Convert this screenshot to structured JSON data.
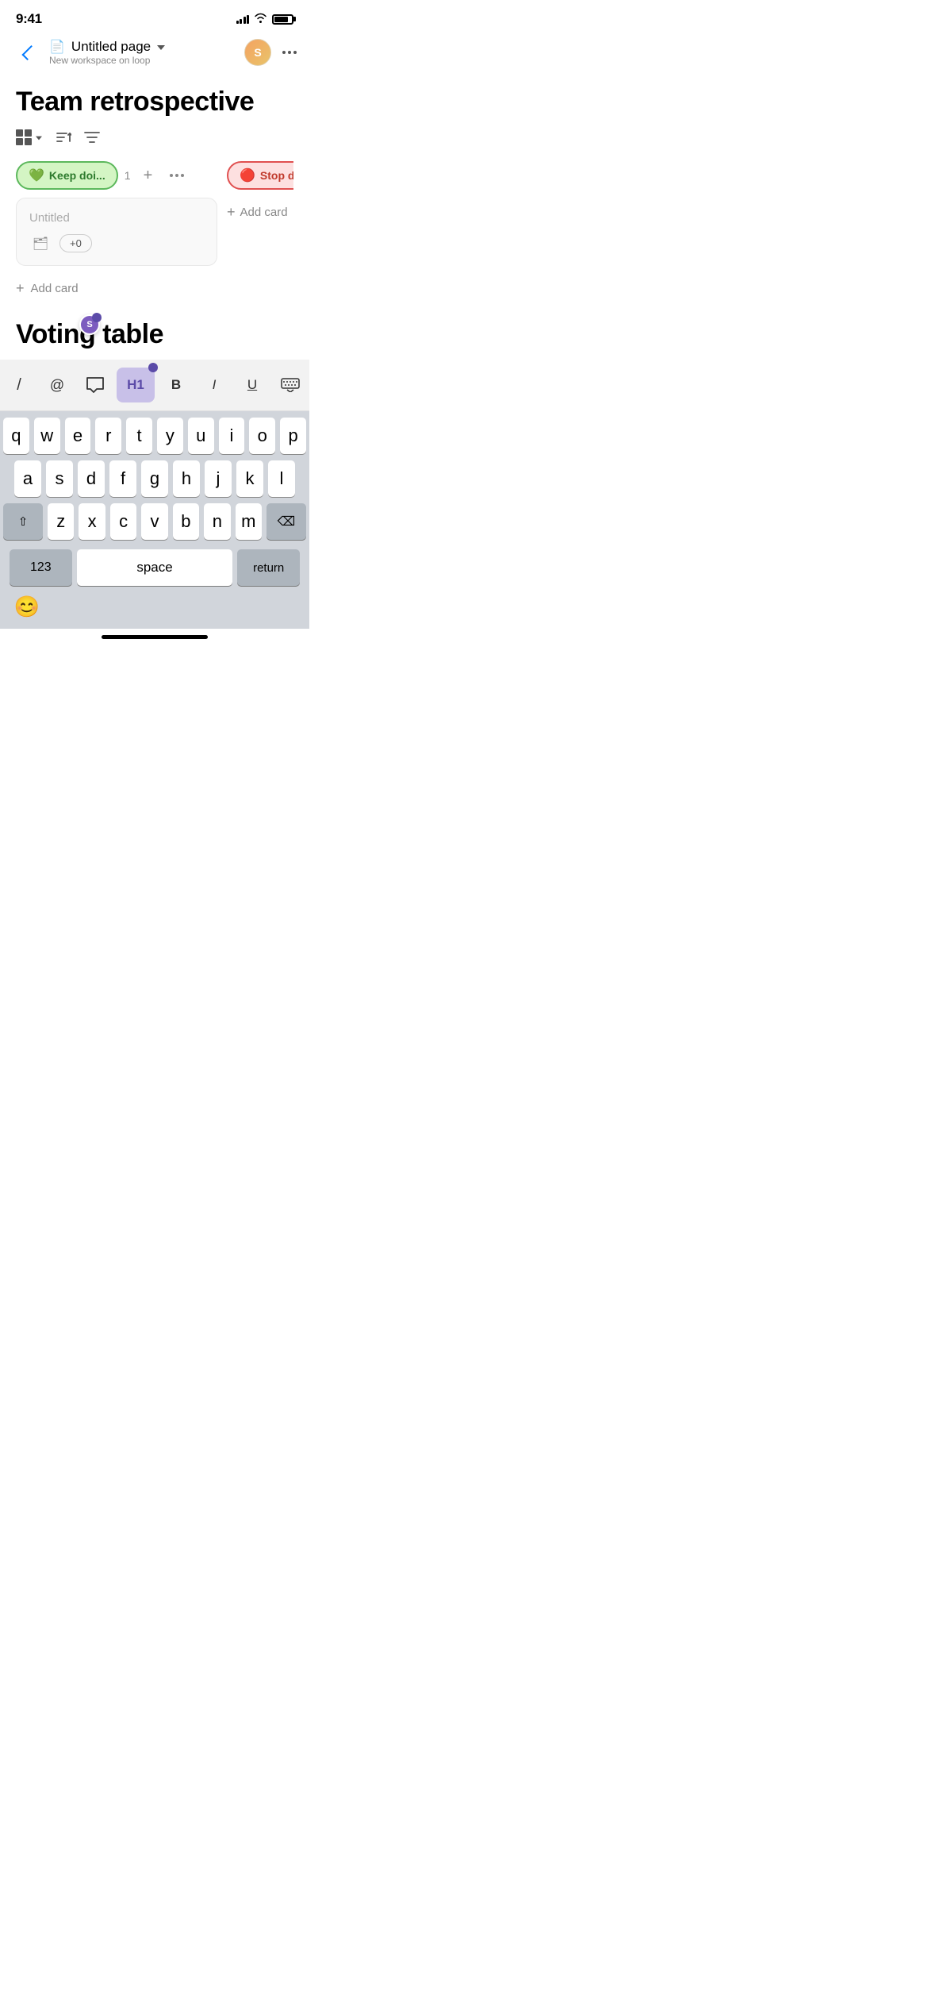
{
  "statusBar": {
    "time": "9:41",
    "signalBars": [
      4,
      6,
      9,
      11,
      13
    ],
    "batteryLevel": 80
  },
  "navHeader": {
    "pageIcon": "📄",
    "pageTitle": "Untitled page",
    "workspaceLabel": "New workspace on loop",
    "avatarInitial": "S",
    "backLabel": "back"
  },
  "mainContent": {
    "pageHeading": "Team retrospective",
    "toolbar": {
      "gridIcon": "grid",
      "sortIcon": "sort",
      "filterIcon": "filter"
    },
    "board": {
      "columns": [
        {
          "id": "keep-doing",
          "label": "Keep doi...",
          "emoji": "💚",
          "count": "1",
          "type": "green"
        },
        {
          "id": "stop-doing",
          "label": "Stop doin...",
          "emoji": "🔴",
          "count": "",
          "type": "red"
        }
      ],
      "card": {
        "title": "Untitled",
        "assignIcon": "🗂",
        "voteBadge": "+0"
      },
      "addCardLabel": "Add card",
      "addCardLabelRight": "Add card"
    }
  },
  "votingSection": {
    "heading": "Voting table"
  },
  "formattingToolbar": {
    "buttons": [
      {
        "id": "slash",
        "label": "/",
        "active": false
      },
      {
        "id": "at",
        "label": "@",
        "active": false
      },
      {
        "id": "comment",
        "label": "💬",
        "active": false
      },
      {
        "id": "h1",
        "label": "H1",
        "active": true
      },
      {
        "id": "bold",
        "label": "B",
        "active": false
      },
      {
        "id": "italic",
        "label": "I",
        "active": false
      },
      {
        "id": "underline",
        "label": "U",
        "active": false
      },
      {
        "id": "keyboard",
        "label": "⌨",
        "active": false
      }
    ]
  },
  "keyboard": {
    "rows": [
      [
        "q",
        "w",
        "e",
        "r",
        "t",
        "y",
        "u",
        "i",
        "o",
        "p"
      ],
      [
        "a",
        "s",
        "d",
        "f",
        "g",
        "h",
        "j",
        "k",
        "l"
      ],
      [
        "z",
        "x",
        "c",
        "v",
        "b",
        "n",
        "m"
      ]
    ],
    "specialKeys": {
      "shift": "⇧",
      "delete": "⌫",
      "numbers": "123",
      "space": "space",
      "return": "return",
      "emoji": "😊"
    }
  }
}
